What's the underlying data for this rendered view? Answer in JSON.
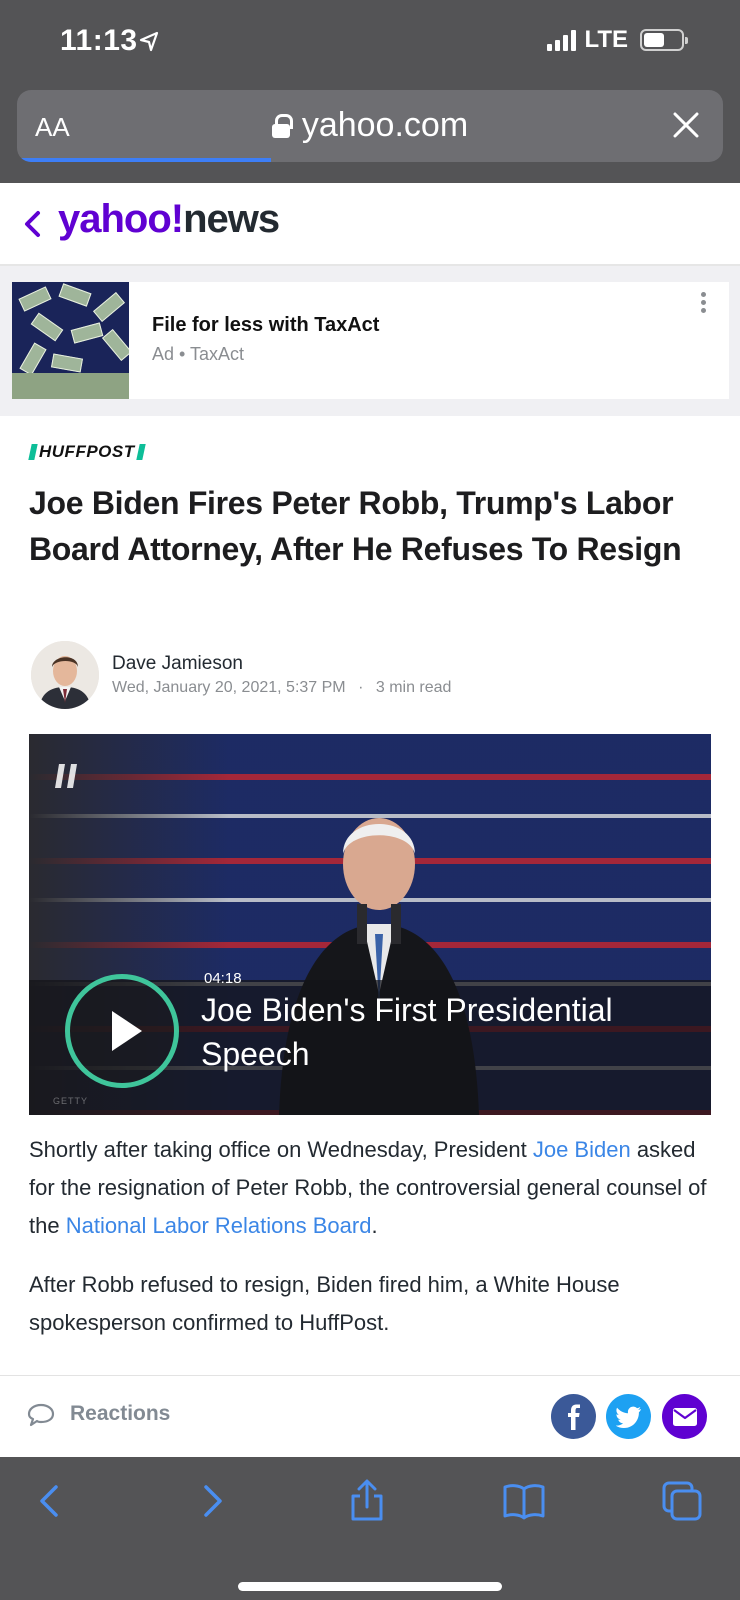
{
  "status_bar": {
    "time": "11:13",
    "network": "LTE",
    "battery_icon": "battery-icon"
  },
  "browser": {
    "text_size_label": "AA",
    "domain": "yahoo.com",
    "load_progress": 0.36,
    "toolbar": [
      "back",
      "forward",
      "share",
      "bookmarks",
      "tabs"
    ]
  },
  "site": {
    "logo_part1": "yahoo!",
    "logo_part2": "news",
    "brand_color": "#6001d2"
  },
  "ad": {
    "title": "File for less with TaxAct",
    "sponsor_line": "Ad • TaxAct"
  },
  "article": {
    "source": "HUFFPOST",
    "headline": "Joe Biden Fires Peter Robb, Trump's Labor Board Attorney, After He Refuses To Resign",
    "author": "Dave Jamieson",
    "date": "Wed, January 20, 2021, 5:37 PM",
    "separator": "·",
    "read_time": "3 min read",
    "video": {
      "duration": "04:18",
      "title": "Joe Biden's First Presidential Speech",
      "credit": "GETTY"
    },
    "para1": {
      "t1": "Shortly after taking office on Wednesday, President ",
      "link1": "Joe Biden",
      "t2": " asked for the resignation of Peter Robb, the controversial general counsel of the ",
      "link2": "National Labor Relations Board",
      "t3": "."
    },
    "para2": "After Robb refused to resign, Biden fired him, a White House spokesperson confirmed to HuffPost."
  },
  "reactions": {
    "label": "Reactions",
    "share_icons": [
      "facebook-icon",
      "twitter-icon",
      "mail-icon"
    ]
  }
}
